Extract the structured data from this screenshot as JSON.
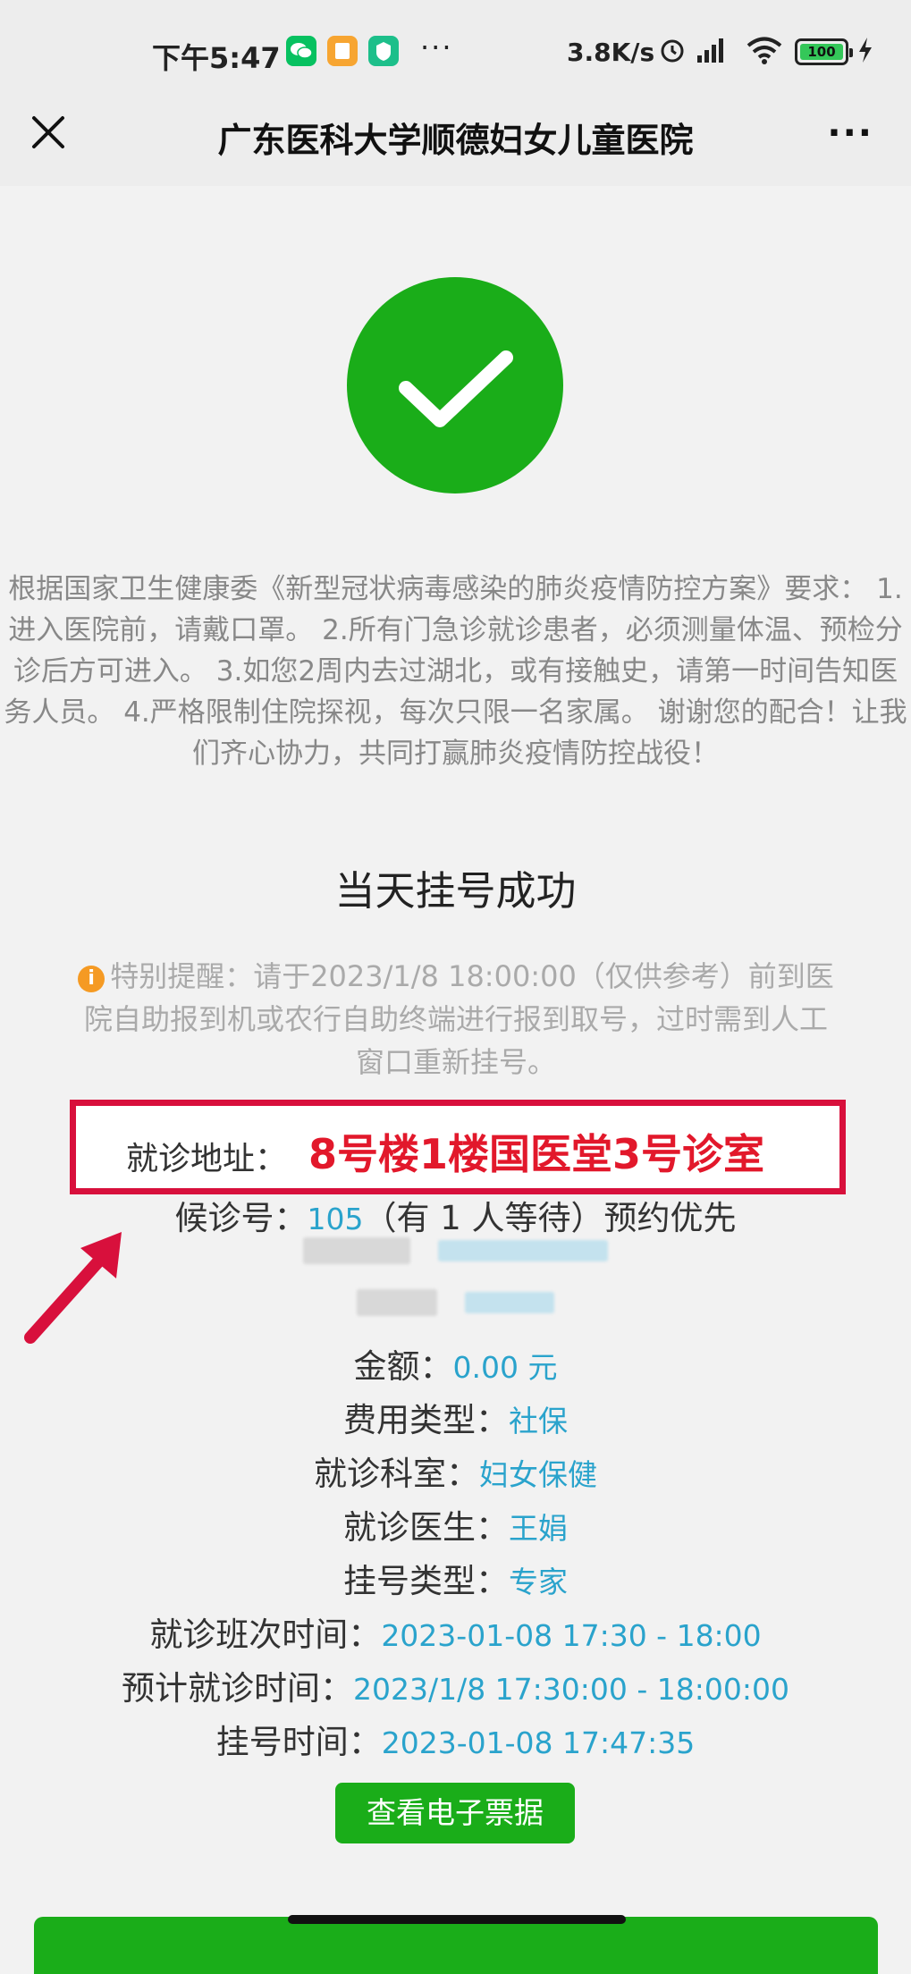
{
  "status_bar": {
    "time": "下午5:47",
    "more": "···",
    "network_speed": "3.8K/s",
    "battery": "100",
    "icons": [
      "wechat-icon",
      "notes-icon",
      "app-icon",
      "alarm-icon",
      "signal-icon",
      "wifi-icon",
      "battery-icon",
      "charging-icon"
    ]
  },
  "nav": {
    "title": "广东医科大学顺德妇女儿童医院",
    "more": "···"
  },
  "notice": "根据国家卫生健康委《新型冠状病毒感染的肺炎疫情防控方案》要求： 1.进入医院前，请戴口罩。 2.所有门急诊就诊患者，必须测量体温、预检分诊后方可进入。 3.如您2周内去过湖北，或有接触史，请第一时间告知医务人员。 4.严格限制住院探视，每次只限一名家属。 谢谢您的配合！让我们齐心协力，共同打赢肺炎疫情防控战役！",
  "success_title": "当天挂号成功",
  "reminder": "特别提醒：请于2023/1/8 18:00:00（仅供参考）前到医院自助报到机或农行自助终端进行报到取号，过时需到人工窗口重新挂号。",
  "address": {
    "label": "就诊地址：",
    "value": "8号楼1楼国医堂3号诊室"
  },
  "details": {
    "queue_label": "候诊号：",
    "queue_number": "105",
    "queue_suffix": "（有 1 人等待）预约优先",
    "amount_label": "金额：",
    "amount_value": "0.00 元",
    "fee_type_label": "费用类型：",
    "fee_type_value": "社保",
    "department_label": "就诊科室：",
    "department_value": "妇女保健",
    "doctor_label": "就诊医生：",
    "doctor_value": "王娟",
    "reg_type_label": "挂号类型：",
    "reg_type_value": "专家",
    "session_label": "就诊班次时间：",
    "session_value": "2023-01-08 17:30 - 18:00",
    "expected_label": "预计就诊时间：",
    "expected_value": "2023/1/8 17:30:00 - 18:00:00",
    "reg_time_label": "挂号时间：",
    "reg_time_value": "2023-01-08 17:47:35"
  },
  "ticket_button": "查看电子票据",
  "colors": {
    "success_green": "#1aad19",
    "highlight_red": "#e2182b",
    "box_border": "#d8103c",
    "link_blue": "#2aa3cc",
    "warning_orange": "#f59a23"
  }
}
